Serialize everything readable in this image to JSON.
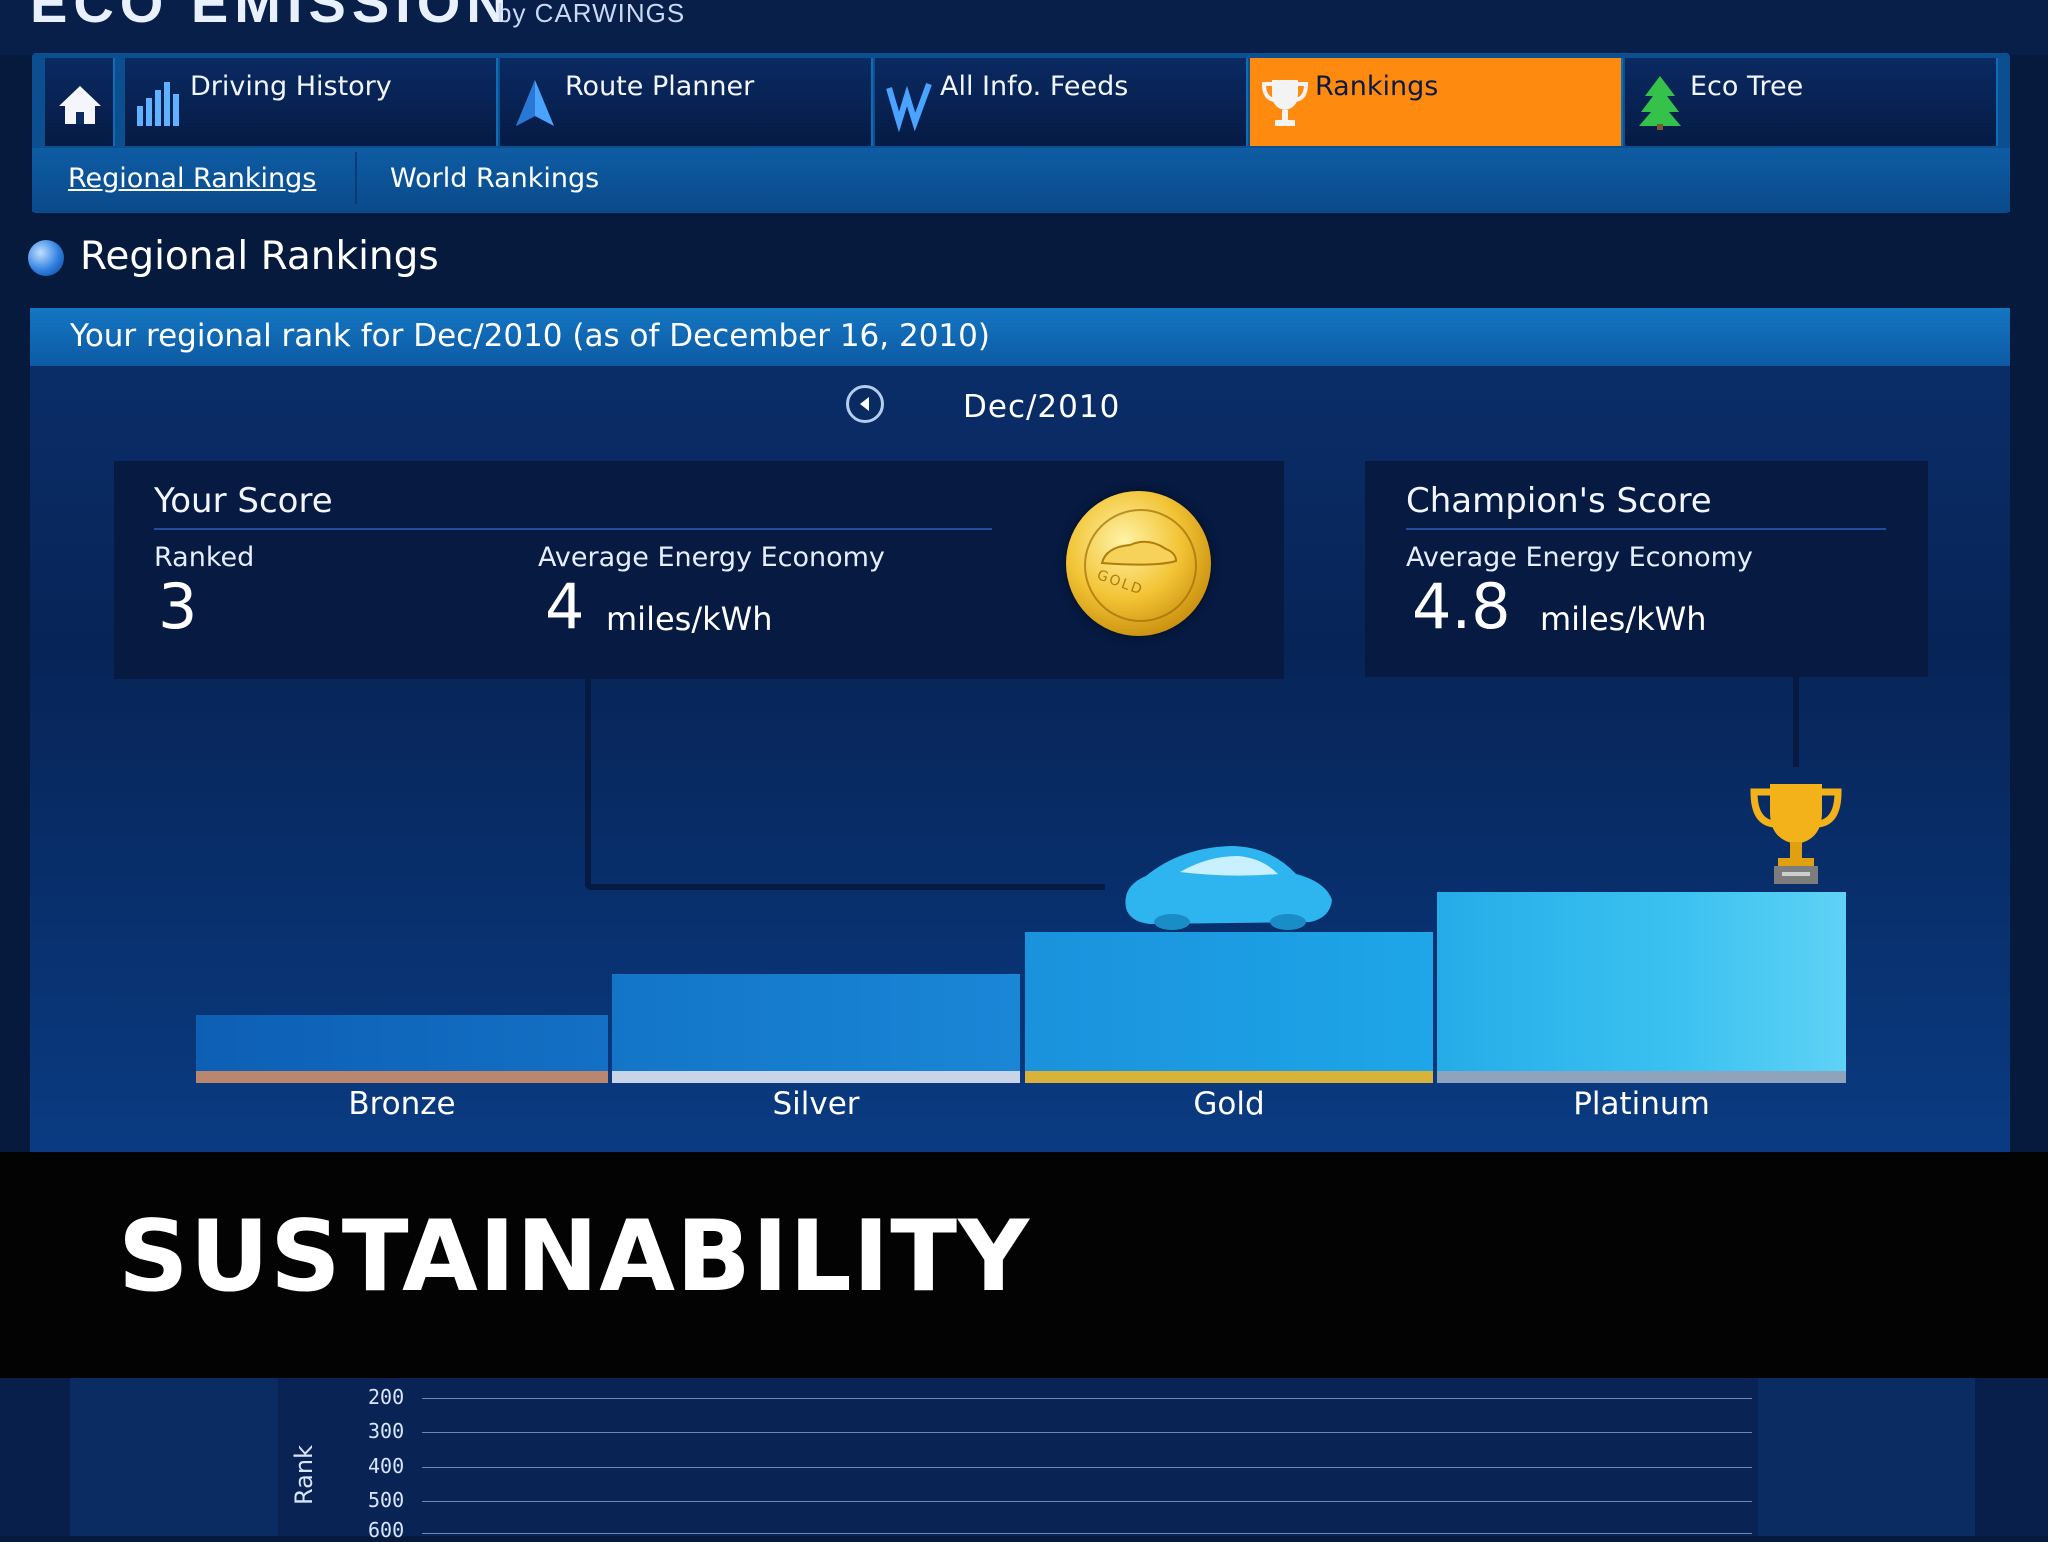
{
  "header": {
    "logo": "ECO EMISSION",
    "subtitle": "by CARWINGS"
  },
  "nav": {
    "home_icon": "home-icon",
    "tabs": [
      {
        "label": "Driving History",
        "icon": "bar-chart-icon"
      },
      {
        "label": "Route Planner",
        "icon": "arrow-icon"
      },
      {
        "label": "All Info. Feeds",
        "icon": "feeds-icon"
      },
      {
        "label": "Rankings",
        "icon": "trophy-icon",
        "active": true
      },
      {
        "label": "Eco Tree",
        "icon": "tree-icon"
      }
    ],
    "subtabs": [
      {
        "label": "Regional Rankings",
        "active": true
      },
      {
        "label": "World Rankings"
      }
    ]
  },
  "section": {
    "title": "Regional Rankings"
  },
  "panel": {
    "header": "Your regional rank for Dec/2010 (as of December 16, 2010)",
    "month": "Dec/2010"
  },
  "your_score": {
    "title": "Your Score",
    "ranked_label": "Ranked",
    "ranked_value": "3",
    "economy_label": "Average Energy Economy",
    "economy_value": "4",
    "unit": "miles/kWh",
    "medal": "GOLD"
  },
  "champion": {
    "title": "Champion's Score",
    "economy_label": "Average Energy Economy",
    "economy_value": "4.8",
    "unit": "miles/kWh"
  },
  "podium": {
    "levels": [
      {
        "label": "Bronze",
        "color": "#b9876f"
      },
      {
        "label": "Silver",
        "color": "#c9d5e6"
      },
      {
        "label": "Gold",
        "color": "#d9b23a"
      },
      {
        "label": "Platinum",
        "color": "#8fa3bd"
      }
    ]
  },
  "banner": {
    "text": "SUSTAINABILITY"
  },
  "bottom_chart": {
    "ylabel": "Rank",
    "ticks": [
      "200",
      "300",
      "400",
      "500",
      "600"
    ]
  },
  "colors": {
    "accent": "#ff8a10",
    "background": "#061a3e",
    "banner": "#030303"
  }
}
